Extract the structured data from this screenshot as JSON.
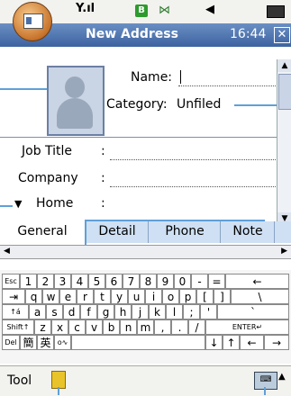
{
  "status_bar": {
    "signal_glyph": "Y.ıl",
    "b_badge": "B",
    "bluetooth_glyph": "⋈",
    "volume_glyph": "◀"
  },
  "title_bar": {
    "title": "New Address",
    "time": "16:44",
    "close_glyph": "✕"
  },
  "form": {
    "name_label": "Name:",
    "name_value": "",
    "category_label": "Category:",
    "category_value": "Unfiled",
    "job_title_label": "Job Title",
    "company_label": "Company",
    "home_label": "Home",
    "separator": ":"
  },
  "tabs": [
    "General",
    "Detail",
    "Phone",
    "Note"
  ],
  "keyboard": {
    "row1": [
      "Esc",
      "1",
      "2",
      "3",
      "4",
      "5",
      "6",
      "7",
      "8",
      "9",
      "0",
      "-",
      "=",
      "←"
    ],
    "row2": [
      "⇥",
      "q",
      "w",
      "e",
      "r",
      "t",
      "y",
      "u",
      "i",
      "o",
      "p",
      "[",
      "]",
      "\\"
    ],
    "row3": [
      "↑á",
      "a",
      "s",
      "d",
      "f",
      "g",
      "h",
      "j",
      "k",
      "l",
      ";",
      "'",
      "`"
    ],
    "row4": [
      "Shift↑",
      "z",
      "x",
      "c",
      "v",
      "b",
      "n",
      "m",
      ",",
      ".",
      "/",
      "ENTER↵"
    ],
    "row5": [
      "Del",
      "簡",
      "英",
      "o∿",
      "",
      "↓",
      "↑",
      "←",
      "→"
    ]
  },
  "bottom_bar": {
    "tool_label": "Tool"
  },
  "colors": {
    "title_bar": "#3d63a0",
    "tab_inactive": "#cfe0f4",
    "callout": "#5fa0d8"
  }
}
